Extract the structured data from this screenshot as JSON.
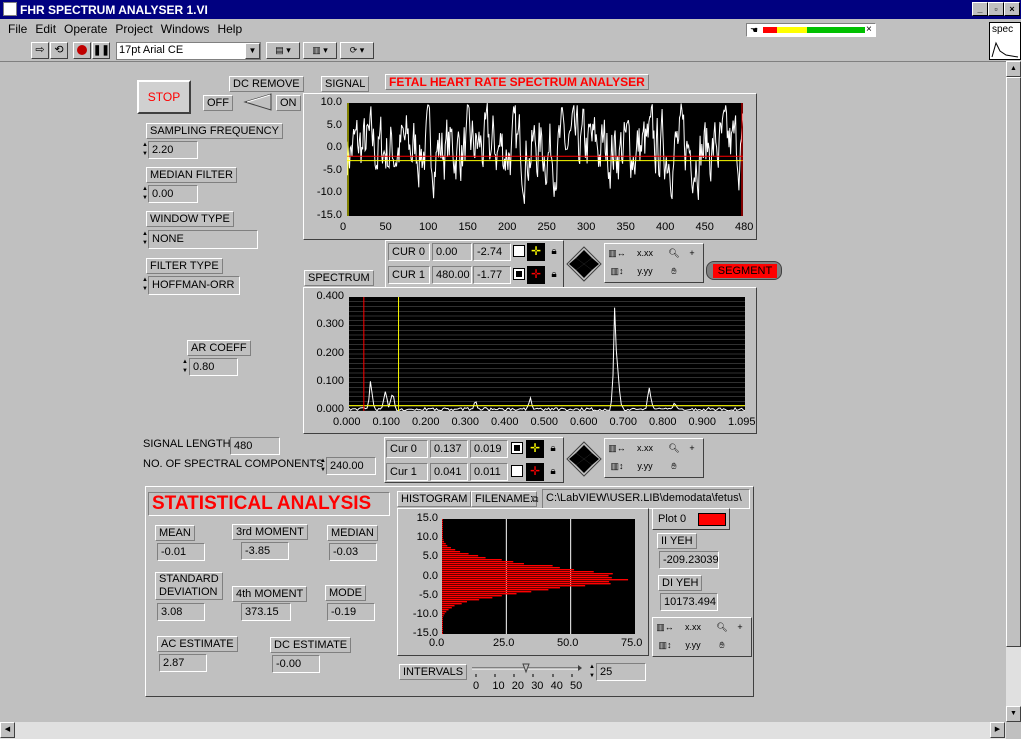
{
  "window": {
    "title": "FHR SPECTRUM ANALYSER 1.VI"
  },
  "menu": [
    "File",
    "Edit",
    "Operate",
    "Project",
    "Windows",
    "Help"
  ],
  "toolbar": {
    "font_select": "17pt Arial CE",
    "vi_icon_label": "spec"
  },
  "colors": {
    "title_bg": "#000080",
    "panel_bg": "#c0c0c0",
    "plot_bg": "#000000",
    "trace": "#ffffff",
    "red": "#ff0000",
    "yellow": "#ffff00"
  },
  "controls": {
    "stop_label": "STOP",
    "dc_remove_label": "DC REMOVE",
    "dc_off": "OFF",
    "dc_on": "ON",
    "sampling_freq_label": "SAMPLING FREQUENCY",
    "sampling_freq_value": "2.20",
    "median_filter_label": "MEDIAN FILTER",
    "median_filter_value": "0.00",
    "window_type_label": "WINDOW TYPE",
    "window_type_value": "NONE",
    "filter_type_label": "FILTER TYPE",
    "filter_type_value": "HOFFMAN-ORR",
    "ar_coeff_label": "AR COEFF",
    "ar_coeff_value": "0.80",
    "signal_length_label": "SIGNAL LENGTH",
    "signal_length_value": "480",
    "spectral_components_label": "NO. OF SPECTRAL COMPONENTS",
    "spectral_components_value": "240.00",
    "segment_label": "SEGMENT"
  },
  "signal_graph": {
    "label": "SIGNAL",
    "title": "FETAL HEART RATE SPECTRUM ANALYSER",
    "y_ticks": [
      "10.0",
      "5.0",
      "0.0",
      "-5.0",
      "-10.0",
      "-15.0"
    ],
    "x_ticks": [
      "0",
      "50",
      "100",
      "150",
      "200",
      "250",
      "300",
      "350",
      "400",
      "450",
      "480"
    ],
    "cursors": [
      {
        "name": "CUR 0",
        "x": "0.00",
        "y": "-2.74"
      },
      {
        "name": "CUR 1",
        "x": "480.00",
        "y": "-1.77"
      }
    ]
  },
  "spectrum_graph": {
    "label": "SPECTRUM",
    "y_ticks": [
      "0.400",
      "0.300",
      "0.200",
      "0.100",
      "0.000"
    ],
    "x_ticks": [
      "0.000",
      "0.100",
      "0.200",
      "0.300",
      "0.400",
      "0.500",
      "0.600",
      "0.700",
      "0.800",
      "0.900",
      "1.095"
    ],
    "cursors": [
      {
        "name": "Cur 0",
        "x": "0.137",
        "y": "0.019"
      },
      {
        "name": "Cur 1",
        "x": "0.041",
        "y": "0.011"
      }
    ]
  },
  "stats": {
    "title": "STATISTICAL  ANALYSIS",
    "mean_label": "MEAN",
    "mean_value": "-0.01",
    "moment3_label": "3rd MOMENT",
    "moment3_value": "-3.85",
    "median_label": "MEDIAN",
    "median_value": "-0.03",
    "std_label_1": "STANDARD",
    "std_label_2": "DEVIATION",
    "std_value": "3.08",
    "moment4_label": "4th MOMENT",
    "moment4_value": "373.15",
    "mode_label": "MODE",
    "mode_value": "-0.19",
    "ac_label": "AC  ESTIMATE",
    "ac_value": "2.87",
    "dc_label": "DC  ESTIMATE",
    "dc_value": "-0.00"
  },
  "histogram": {
    "label": "HISTOGRAM",
    "filename_label": "FILENAME:",
    "filename_value": "C:\\LabVIEW\\USER.LIB\\demodata\\fetus\\",
    "plot_legend": "Plot 0",
    "y_ticks": [
      "15.0",
      "10.0",
      "5.0",
      "0.0",
      "-5.0",
      "-10.0",
      "-15.0"
    ],
    "x_ticks": [
      "0.0",
      "25.0",
      "50.0",
      "75.0"
    ],
    "ii_yeh_label": "II  YEH",
    "ii_yeh_value": "-209.23039",
    "di_yeh_label": "DI  YEH",
    "di_yeh_value": "10173.494",
    "intervals_label": "INTERVALS",
    "intervals_value": "25",
    "intervals_ticks": [
      "0",
      "10",
      "20",
      "30",
      "40",
      "50"
    ]
  }
}
